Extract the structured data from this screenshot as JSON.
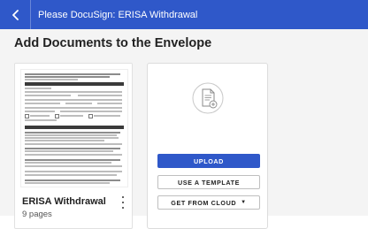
{
  "topbar": {
    "back_icon": "chevron-left-icon",
    "title": "Please DocuSign: ERISA Withdrawal",
    "background": "#2f58c9"
  },
  "page": {
    "title": "Add Documents to the Envelope"
  },
  "document": {
    "name": "ERISA Withdrawal",
    "pages": "9 pages",
    "menu_icon": "kebab-menu-icon"
  },
  "upload_panel": {
    "icon": "add-document-icon",
    "upload_label": "UPLOAD",
    "template_label": "USE A TEMPLATE",
    "cloud_label": "GET FROM CLOUD",
    "cloud_caret": "▼",
    "accent": "#2f58c9"
  }
}
